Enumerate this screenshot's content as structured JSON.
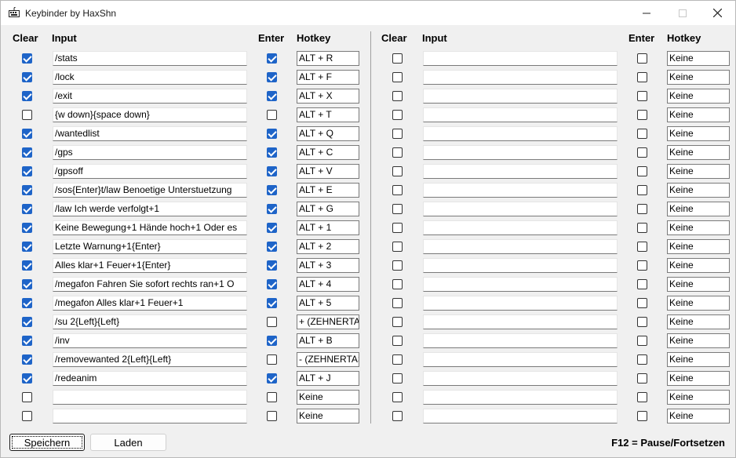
{
  "window": {
    "title": "Keybinder by HaxShn"
  },
  "headers": {
    "clear": "Clear",
    "input": "Input",
    "enter": "Enter",
    "hotkey": "Hotkey"
  },
  "left_rows": [
    {
      "clear": true,
      "input": "/stats",
      "enter": true,
      "hotkey": "ALT + R"
    },
    {
      "clear": true,
      "input": "/lock",
      "enter": true,
      "hotkey": "ALT + F"
    },
    {
      "clear": true,
      "input": "/exit",
      "enter": true,
      "hotkey": "ALT + X"
    },
    {
      "clear": false,
      "input": "{w down}{space down}",
      "enter": false,
      "hotkey": "ALT + T"
    },
    {
      "clear": true,
      "input": "/wantedlist",
      "enter": true,
      "hotkey": "ALT + Q"
    },
    {
      "clear": true,
      "input": "/gps",
      "enter": true,
      "hotkey": "ALT + C"
    },
    {
      "clear": true,
      "input": "/gpsoff",
      "enter": true,
      "hotkey": "ALT + V"
    },
    {
      "clear": true,
      "input": "/sos{Enter}t/law Benoetige Unterstuetzung",
      "enter": true,
      "hotkey": "ALT + E"
    },
    {
      "clear": true,
      "input": "/law Ich werde verfolgt+1",
      "enter": true,
      "hotkey": "ALT + G"
    },
    {
      "clear": true,
      "input": "Keine Bewegung+1 Hände hoch+1 Oder es",
      "enter": true,
      "hotkey": "ALT + 1"
    },
    {
      "clear": true,
      "input": "Letzte Warnung+1{Enter}",
      "enter": true,
      "hotkey": "ALT + 2"
    },
    {
      "clear": true,
      "input": "Alles klar+1 Feuer+1{Enter}",
      "enter": true,
      "hotkey": "ALT + 3"
    },
    {
      "clear": true,
      "input": "/megafon Fahren Sie sofort rechts ran+1 O",
      "enter": true,
      "hotkey": "ALT + 4"
    },
    {
      "clear": true,
      "input": "/megafon Alles klar+1 Feuer+1",
      "enter": true,
      "hotkey": "ALT + 5"
    },
    {
      "clear": true,
      "input": "/su  2{Left}{Left}",
      "enter": false,
      "hotkey": "+ (ZEHNERTASTATUR)"
    },
    {
      "clear": true,
      "input": "/inv",
      "enter": true,
      "hotkey": "ALT + B"
    },
    {
      "clear": true,
      "input": "/removewanted  2{Left}{Left}",
      "enter": false,
      "hotkey": "- (ZEHNERTASTATUR)"
    },
    {
      "clear": true,
      "input": "/redeanim",
      "enter": true,
      "hotkey": "ALT + J"
    },
    {
      "clear": false,
      "input": "",
      "enter": false,
      "hotkey": "Keine"
    },
    {
      "clear": false,
      "input": "",
      "enter": false,
      "hotkey": "Keine"
    }
  ],
  "right_rows": [
    {
      "clear": false,
      "input": "",
      "enter": false,
      "hotkey": "Keine"
    },
    {
      "clear": false,
      "input": "",
      "enter": false,
      "hotkey": "Keine"
    },
    {
      "clear": false,
      "input": "",
      "enter": false,
      "hotkey": "Keine"
    },
    {
      "clear": false,
      "input": "",
      "enter": false,
      "hotkey": "Keine"
    },
    {
      "clear": false,
      "input": "",
      "enter": false,
      "hotkey": "Keine"
    },
    {
      "clear": false,
      "input": "",
      "enter": false,
      "hotkey": "Keine"
    },
    {
      "clear": false,
      "input": "",
      "enter": false,
      "hotkey": "Keine"
    },
    {
      "clear": false,
      "input": "",
      "enter": false,
      "hotkey": "Keine"
    },
    {
      "clear": false,
      "input": "",
      "enter": false,
      "hotkey": "Keine"
    },
    {
      "clear": false,
      "input": "",
      "enter": false,
      "hotkey": "Keine"
    },
    {
      "clear": false,
      "input": "",
      "enter": false,
      "hotkey": "Keine"
    },
    {
      "clear": false,
      "input": "",
      "enter": false,
      "hotkey": "Keine"
    },
    {
      "clear": false,
      "input": "",
      "enter": false,
      "hotkey": "Keine"
    },
    {
      "clear": false,
      "input": "",
      "enter": false,
      "hotkey": "Keine"
    },
    {
      "clear": false,
      "input": "",
      "enter": false,
      "hotkey": "Keine"
    },
    {
      "clear": false,
      "input": "",
      "enter": false,
      "hotkey": "Keine"
    },
    {
      "clear": false,
      "input": "",
      "enter": false,
      "hotkey": "Keine"
    },
    {
      "clear": false,
      "input": "",
      "enter": false,
      "hotkey": "Keine"
    },
    {
      "clear": false,
      "input": "",
      "enter": false,
      "hotkey": "Keine"
    },
    {
      "clear": false,
      "input": "",
      "enter": false,
      "hotkey": "Keine"
    }
  ],
  "footer": {
    "save_label": "Speichern",
    "load_label": "Laden",
    "status_text": "F12 = Pause/Fortsetzen"
  },
  "colors": {
    "checkbox_checked": "#1e64c8",
    "background": "#f0f0f0"
  },
  "icons": {
    "app": "keyboard-icon",
    "minimize": "minimize-icon",
    "maximize": "maximize-icon",
    "close": "close-icon"
  }
}
